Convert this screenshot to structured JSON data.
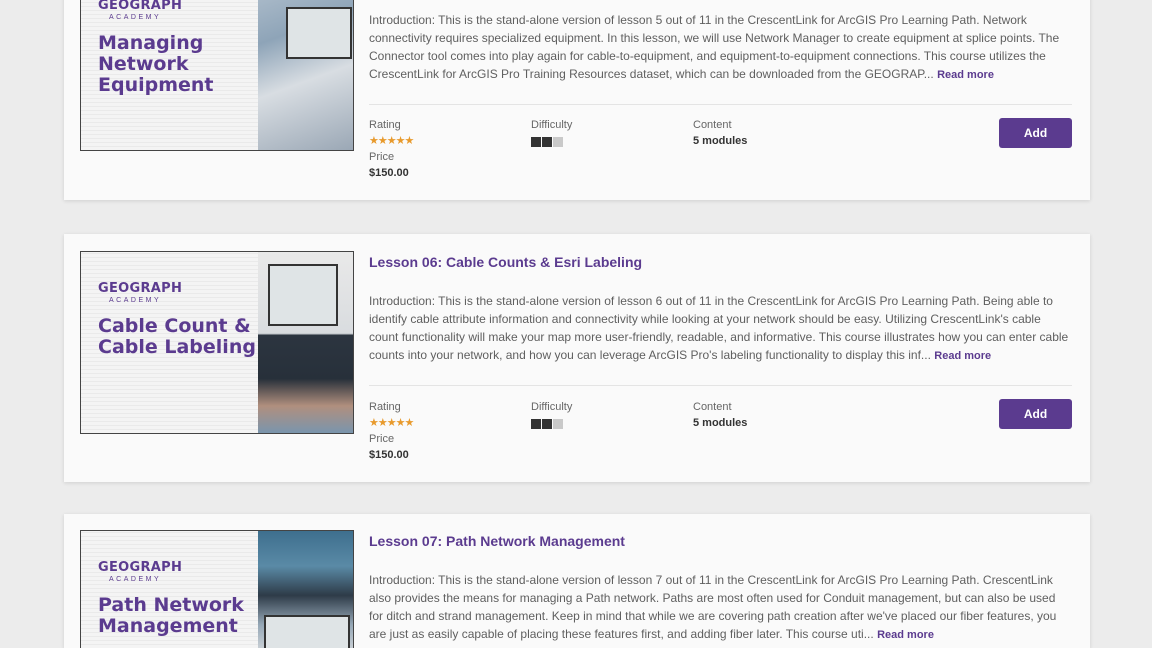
{
  "courses": [
    {
      "brand": "GEOGRAPH",
      "brand_sub": "ACADEMY",
      "thumb_title": "Managing Network Equipment",
      "title": "",
      "description": "Introduction: This is the stand-alone version of lesson 5 out of 11 in the CrescentLink for ArcGIS Pro Learning Path. Network connectivity requires specialized equipment. In this lesson, we will use Network Manager to create equipment at splice points. The Connector tool comes into play again for cable-to-equipment, and equipment-to-equipment connections. This course utilizes the CrescentLink for ArcGIS Pro Training Resources dataset, which can be downloaded from the GEOGRAP...",
      "read_more": "Read more",
      "rating_label": "Rating",
      "rating_stars": "★★★★★",
      "rating_value": 5,
      "difficulty_label": "Difficulty",
      "difficulty_level": 2,
      "difficulty_max": 3,
      "content_label": "Content",
      "content_value": "5 modules",
      "price_label": "Price",
      "price_value": "$150.00",
      "add_label": "Add"
    },
    {
      "brand": "GEOGRAPH",
      "brand_sub": "ACADEMY",
      "thumb_title": "Cable Count & Cable Labeling",
      "title": "Lesson 06: Cable Counts & Esri Labeling",
      "description": "Introduction: This is the stand-alone version of lesson 6 out of 11 in the CrescentLink for ArcGIS Pro Learning Path. Being able to identify cable attribute information and connectivity while looking at your network should be easy.  Utilizing CrescentLink's cable count functionality will make your map more user-friendly, readable, and informative.  This course illustrates how you can enter cable counts into your network, and how you can leverage ArcGIS Pro's labeling functionality to display this inf...",
      "read_more": "Read more",
      "rating_label": "Rating",
      "rating_stars": "★★★★★",
      "rating_value": 5,
      "difficulty_label": "Difficulty",
      "difficulty_level": 2,
      "difficulty_max": 3,
      "content_label": "Content",
      "content_value": "5 modules",
      "price_label": "Price",
      "price_value": "$150.00",
      "add_label": "Add"
    },
    {
      "brand": "GEOGRAPH",
      "brand_sub": "ACADEMY",
      "thumb_title": "Path Network Management",
      "title": "Lesson 07: Path Network Management",
      "description": "Introduction: This is the stand-alone version of lesson 7 out of 11 in the CrescentLink for ArcGIS Pro Learning Path. CrescentLink also provides the means for managing a Path network. Paths are most often used for Conduit management, but can also be used for ditch and strand management.  Keep in mind that while we are covering path creation after we've placed our fiber features, you are just as easily capable of placing these features first, and adding fiber later. This course uti...",
      "read_more": "Read more"
    }
  ],
  "colors": {
    "accent": "#5b3b8f",
    "star": "#e89a2c",
    "page_bg": "#ececec",
    "card_bg": "#fafafa"
  }
}
